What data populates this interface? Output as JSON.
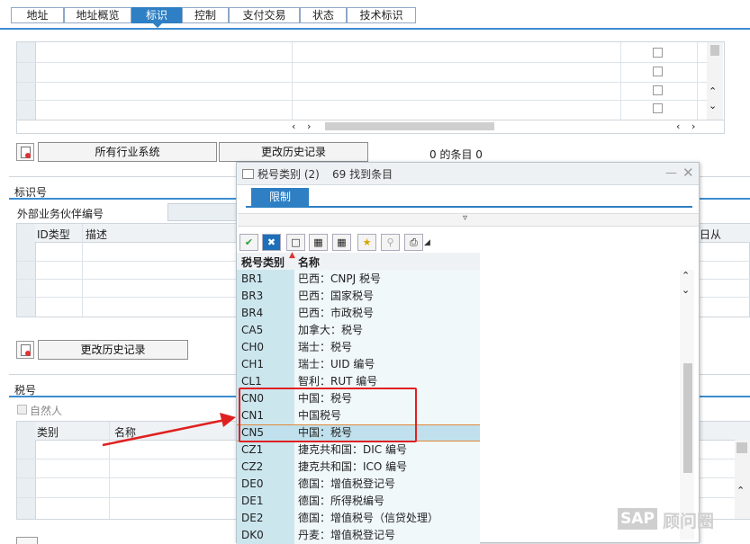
{
  "tabs": [
    "地址",
    "地址概览",
    "标识",
    "控制",
    "支付交易",
    "状态",
    "技术标识"
  ],
  "active_tab": 2,
  "upper_section": {
    "btn_all_industry": "所有行业系统",
    "btn_change_history": "更改历史记录",
    "entries_label": "0 的条目 0"
  },
  "id_section": {
    "title": "标识号",
    "ext_partner_label": "外部业务伙伴编号",
    "columns": [
      "ID类型",
      "描述"
    ],
    "right_col_fragment": "日从",
    "btn_change_history": "更改历史记录"
  },
  "tax_section": {
    "title": "税号",
    "natural_person": "自然人",
    "columns": [
      "类别",
      "名称"
    ]
  },
  "popup": {
    "title": "税号类别 (2)",
    "found": "69 找到条目",
    "restrict_tab": "限制",
    "col_key": "税号类别",
    "col_name": "名称",
    "rows": [
      {
        "k": "BR1",
        "v": "巴西：CNPJ 税号"
      },
      {
        "k": "BR3",
        "v": "巴西：国家税号"
      },
      {
        "k": "BR4",
        "v": "巴西：市政税号"
      },
      {
        "k": "CA5",
        "v": "加拿大：税号"
      },
      {
        "k": "CH0",
        "v": "瑞士：税号"
      },
      {
        "k": "CH1",
        "v": "瑞士：UID 编号"
      },
      {
        "k": "CL1",
        "v": "智利：RUT 编号"
      },
      {
        "k": "CN0",
        "v": "中国：税号"
      },
      {
        "k": "CN1",
        "v": "中国税号"
      },
      {
        "k": "CN5",
        "v": "中国：税号"
      },
      {
        "k": "CZ1",
        "v": "捷克共和国：DIC 编号"
      },
      {
        "k": "CZ2",
        "v": "捷克共和国：ICO 编号"
      },
      {
        "k": "DE0",
        "v": "德国：增值税登记号"
      },
      {
        "k": "DE1",
        "v": "德国：所得税编号"
      },
      {
        "k": "DE2",
        "v": "德国：增值税号（信贷处理）"
      },
      {
        "k": "DK0",
        "v": "丹麦：增值税登记号"
      }
    ],
    "selected_index": 9
  },
  "watermark": {
    "brand": "SAP",
    "text": "顾问圈"
  },
  "colors": {
    "accent": "#2e7fc3",
    "highlight_box": "#e02020",
    "key_col": "#cce6ee"
  }
}
